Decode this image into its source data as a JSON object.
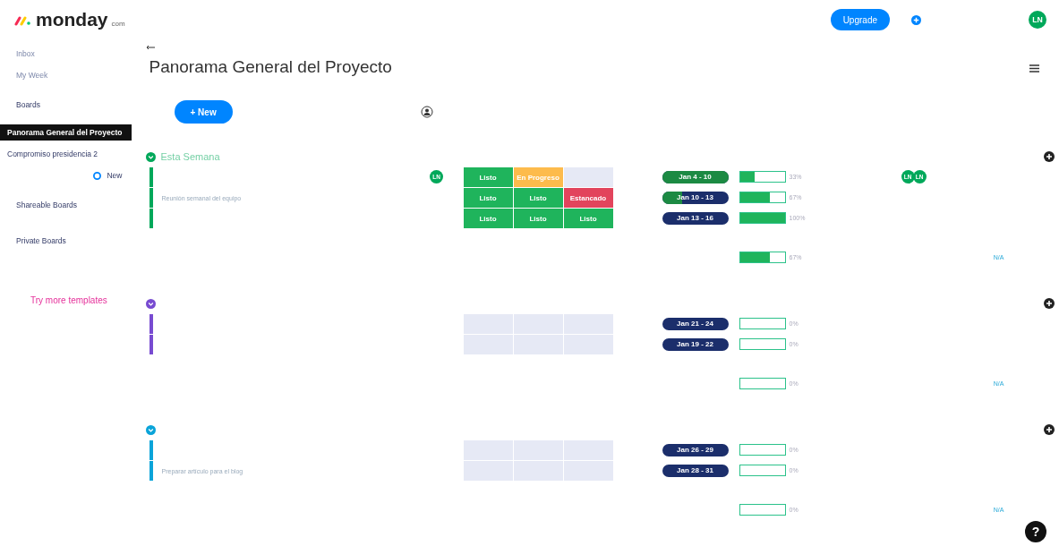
{
  "topbar": {
    "logo": "monday",
    "logo_suffix": "com",
    "upgrade": "Upgrade",
    "avatar": "LN"
  },
  "sidebar": {
    "items": [
      {
        "kind": "link",
        "label": "Inbox"
      },
      {
        "kind": "link",
        "label": "My Week"
      },
      {
        "kind": "section",
        "label": "Boards"
      },
      {
        "kind": "board",
        "label": "Panorama General del Proyecto",
        "selected": true
      },
      {
        "kind": "board",
        "label": "Compromiso presidencia 2",
        "selected": false
      },
      {
        "kind": "new",
        "label": "New"
      },
      {
        "kind": "section",
        "label": "Shareable Boards"
      },
      {
        "kind": "section",
        "label": "Private Boards"
      },
      {
        "kind": "templates",
        "label": "Try more templates"
      }
    ]
  },
  "board": {
    "title": "Panorama General del Proyecto",
    "new_button": "+ New",
    "groups": [
      {
        "title": "Esta Semana",
        "color": "#00a85a",
        "rows": [
          {
            "person": "LN",
            "statuses": [
              {
                "label": "Listo",
                "color": "#1fb45c"
              },
              {
                "label": "En Progreso",
                "color": "#fdbb4c"
              },
              {
                "color": "#e6e9f5"
              }
            ],
            "timeline": {
              "label": "Jan 4 - 10",
              "level": 1
            },
            "progress": {
              "level": 0.33,
              "reading": "33%"
            },
            "people": [
              "LN",
              "LN"
            ]
          },
          {
            "name": "Reunión semanal del equipo",
            "statuses": [
              {
                "label": "Listo",
                "color": "#1fb45c"
              },
              {
                "label": "Listo",
                "color": "#1fb45c"
              },
              {
                "label": "Estancado",
                "color": "#e2445c"
              }
            ],
            "timeline": {
              "label": "Jan 10 - 13",
              "level": 0.3
            },
            "progress": {
              "level": 0.67,
              "reading": "67%"
            }
          },
          {
            "statuses": [
              {
                "label": "Listo",
                "color": "#1fb45c"
              },
              {
                "label": "Listo",
                "color": "#1fb45c"
              },
              {
                "label": "Listo",
                "color": "#1fb45c"
              }
            ],
            "timeline": {
              "label": "Jan 13 - 16",
              "level": 0
            },
            "progress": {
              "level": 1,
              "reading": "100%"
            }
          }
        ],
        "summary": {
          "level": 0.67,
          "reading": "67%",
          "status": "N/A"
        }
      },
      {
        "color": "#784bd1",
        "rows": [
          {
            "statuses": [
              {
                "color": "#e6e9f5"
              },
              {
                "color": "#e6e9f5"
              },
              {
                "color": "#e6e9f5"
              }
            ],
            "timeline": {
              "label": "Jan 21 - 24",
              "level": 0
            },
            "progress": {
              "level": 0,
              "reading": "0%"
            }
          },
          {
            "statuses": [
              {
                "color": "#e6e9f5"
              },
              {
                "color": "#e6e9f5"
              },
              {
                "color": "#e6e9f5"
              }
            ],
            "timeline": {
              "label": "Jan 19 - 22",
              "level": 0
            },
            "progress": {
              "level": 0,
              "reading": "0%"
            }
          }
        ],
        "summary": {
          "level": 0,
          "reading": "0%",
          "status": "N/A"
        }
      },
      {
        "color": "#0aa4d9",
        "rows": [
          {
            "statuses": [
              {
                "color": "#e6e9f5"
              },
              {
                "color": "#e6e9f5"
              },
              {
                "color": "#e6e9f5"
              }
            ],
            "timeline": {
              "label": "Jan 26 - 29",
              "level": 0
            },
            "progress": {
              "level": 0,
              "reading": "0%"
            }
          },
          {
            "name": "Preparar artículo para el blog",
            "statuses": [
              {
                "color": "#e6e9f5"
              },
              {
                "color": "#e6e9f5"
              },
              {
                "color": "#e6e9f5"
              }
            ],
            "timeline": {
              "label": "Jan 28 - 31",
              "level": 0
            },
            "progress": {
              "level": 0,
              "reading": "0%"
            }
          }
        ],
        "summary": {
          "level": 0,
          "reading": "0%",
          "status": "N/A"
        }
      }
    ]
  },
  "help": "?"
}
